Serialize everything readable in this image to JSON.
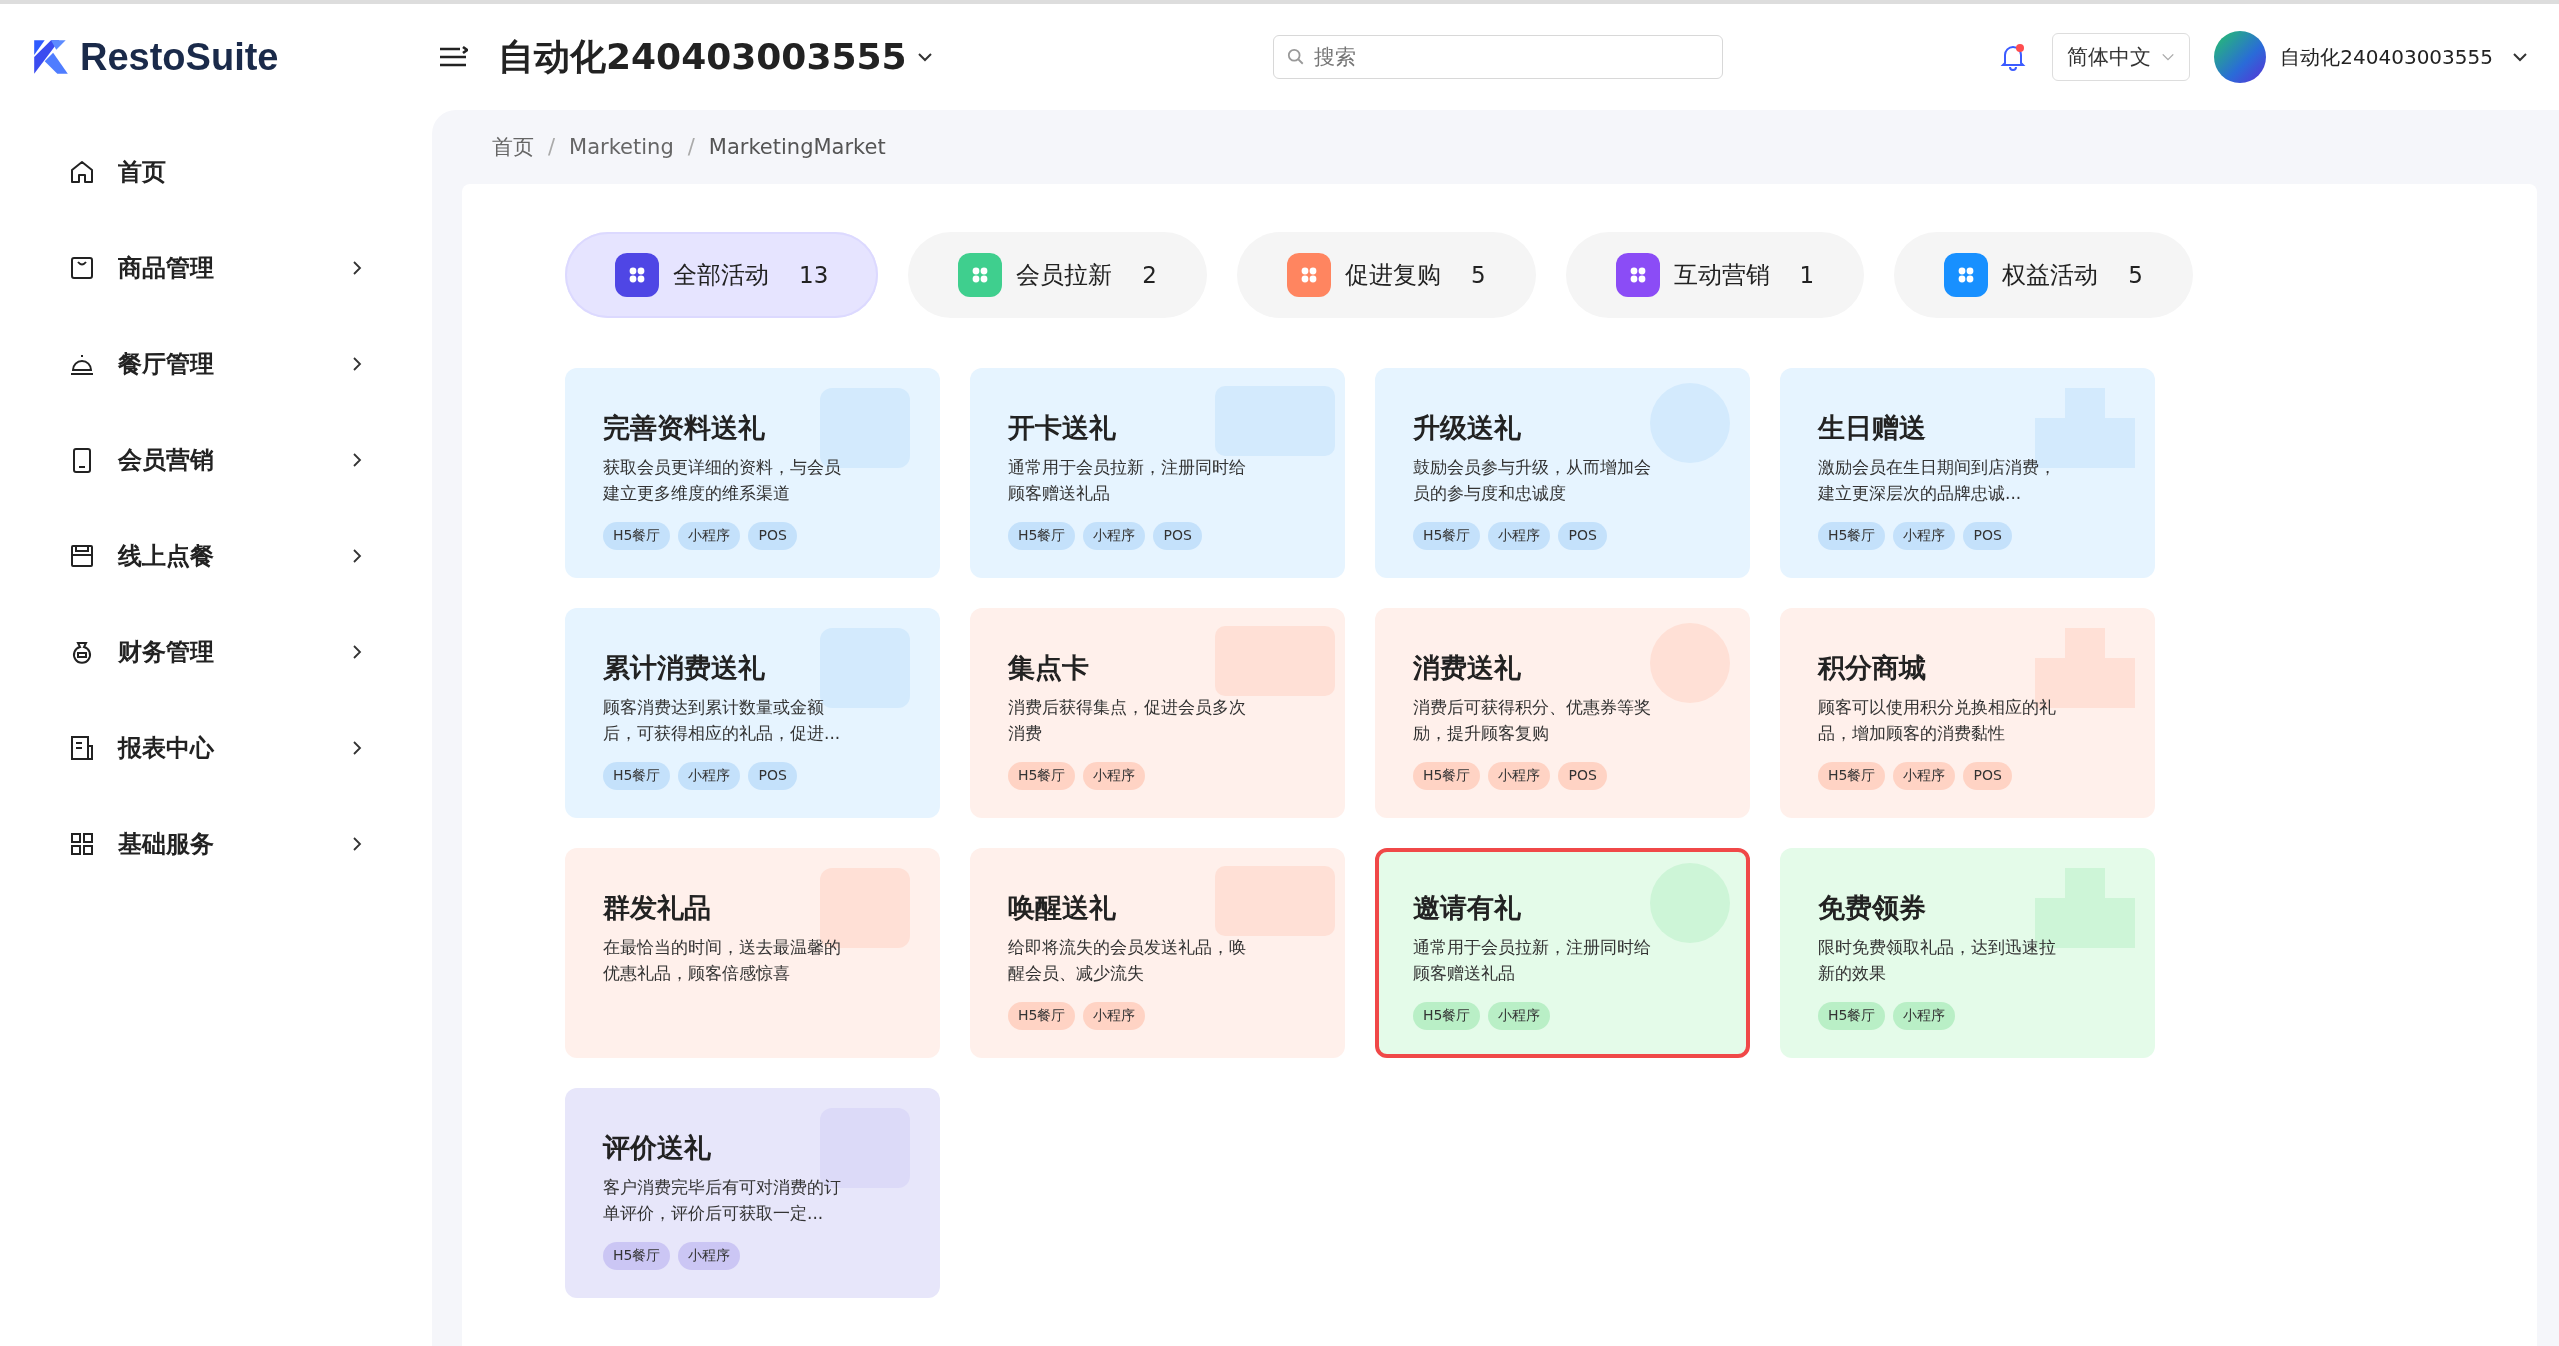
{
  "header": {
    "logo": "RestoSuite",
    "store": "自动化240403003555",
    "search": {
      "placeholder": "搜索"
    },
    "notifications": {
      "unread": true
    },
    "language": "简体中文",
    "user": "自动化240403003555"
  },
  "sidebar": {
    "items": [
      {
        "label": "首页",
        "kind": "link"
      },
      {
        "label": "商品管理",
        "kind": "group"
      },
      {
        "label": "餐厅管理",
        "kind": "group"
      },
      {
        "label": "会员营销",
        "kind": "group"
      },
      {
        "label": "线上点餐",
        "kind": "group"
      },
      {
        "label": "财务管理",
        "kind": "group"
      },
      {
        "label": "报表中心",
        "kind": "group"
      },
      {
        "label": "基础服务",
        "kind": "group"
      }
    ]
  },
  "breadcrumb": {
    "separator": "/",
    "items": [
      "首页",
      "Marketing",
      "MarketingMarket"
    ]
  },
  "tabs": [
    {
      "label": "全部活动",
      "count": "13",
      "selected": true,
      "color": "#4f46e5"
    },
    {
      "label": "会员拉新",
      "count": "2",
      "selected": false,
      "color": "#3fcf8e"
    },
    {
      "label": "促进复购",
      "count": "5",
      "selected": false,
      "color": "#ff8560"
    },
    {
      "label": "互动营销",
      "count": "1",
      "selected": false,
      "color": "#8b4cf6"
    },
    {
      "label": "权益活动",
      "count": "5",
      "selected": false,
      "color": "#1890ff"
    }
  ],
  "cards": [
    {
      "title": "完善资料送礼",
      "description": "获取会员更详细的资料，与会员建立更多维度的维系渠道",
      "tags": [
        "H5餐厅",
        "小程序",
        "POS"
      ],
      "color": "#e6f4ff",
      "selected": false
    },
    {
      "title": "开卡送礼",
      "description": "通常用于会员拉新，注册同时给顾客赠送礼品",
      "tags": [
        "H5餐厅",
        "小程序",
        "POS"
      ],
      "color": "#e6f4ff",
      "selected": false
    },
    {
      "title": "升级送礼",
      "description": "鼓励会员参与升级，从而增加会员的参与度和忠诚度",
      "tags": [
        "H5餐厅",
        "小程序",
        "POS"
      ],
      "color": "#e6f4ff",
      "selected": false
    },
    {
      "title": "生日赠送",
      "description": "激励会员在生日期间到店消费，建立更深层次的品牌忠诚...",
      "tags": [
        "H5餐厅",
        "小程序",
        "POS"
      ],
      "color": "#e6f4ff",
      "selected": false
    },
    {
      "title": "累计消费送礼",
      "description": "顾客消费达到累计数量或金额后，可获得相应的礼品，促进...",
      "tags": [
        "H5餐厅",
        "小程序",
        "POS"
      ],
      "color": "#e6f4ff",
      "selected": false
    },
    {
      "title": "集点卡",
      "description": "消费后获得集点，促进会员多次消费",
      "tags": [
        "H5餐厅",
        "小程序"
      ],
      "color": "#fff0eb",
      "selected": false
    },
    {
      "title": "消费送礼",
      "description": "消费后可获得积分、优惠券等奖励，提升顾客复购",
      "tags": [
        "H5餐厅",
        "小程序",
        "POS"
      ],
      "color": "#fff0eb",
      "selected": false
    },
    {
      "title": "积分商城",
      "description": "顾客可以使用积分兑换相应的礼品，增加顾客的消费黏性",
      "tags": [
        "H5餐厅",
        "小程序",
        "POS"
      ],
      "color": "#fff0eb",
      "selected": false
    },
    {
      "title": "群发礼品",
      "description": "在最恰当的时间，送去最温馨的优惠礼品，顾客倍感惊喜",
      "color": "#fff0eb",
      "selected": false
    },
    {
      "title": "唤醒送礼",
      "description": "给即将流失的会员发送礼品，唤醒会员、减少流失",
      "tags": [
        "H5餐厅",
        "小程序"
      ],
      "color": "#fff0eb",
      "selected": false
    },
    {
      "title": "邀请有礼",
      "description": "通常用于会员拉新，注册同时给顾客赠送礼品",
      "tags": [
        "H5餐厅",
        "小程序"
      ],
      "color": "#e4fbe9",
      "selected": true
    },
    {
      "title": "免费领券",
      "description": "限时免费领取礼品，达到迅速拉新的效果",
      "tags": [
        "H5餐厅",
        "小程序"
      ],
      "color": "#e4fbe9",
      "selected": false
    },
    {
      "title": "评价送礼",
      "description": "客户消费完毕后有可对消费的订单评价，评价后可获取一定...",
      "tags": [
        "H5餐厅",
        "小程序"
      ],
      "color": "#e7e6fa",
      "selected": false
    }
  ]
}
